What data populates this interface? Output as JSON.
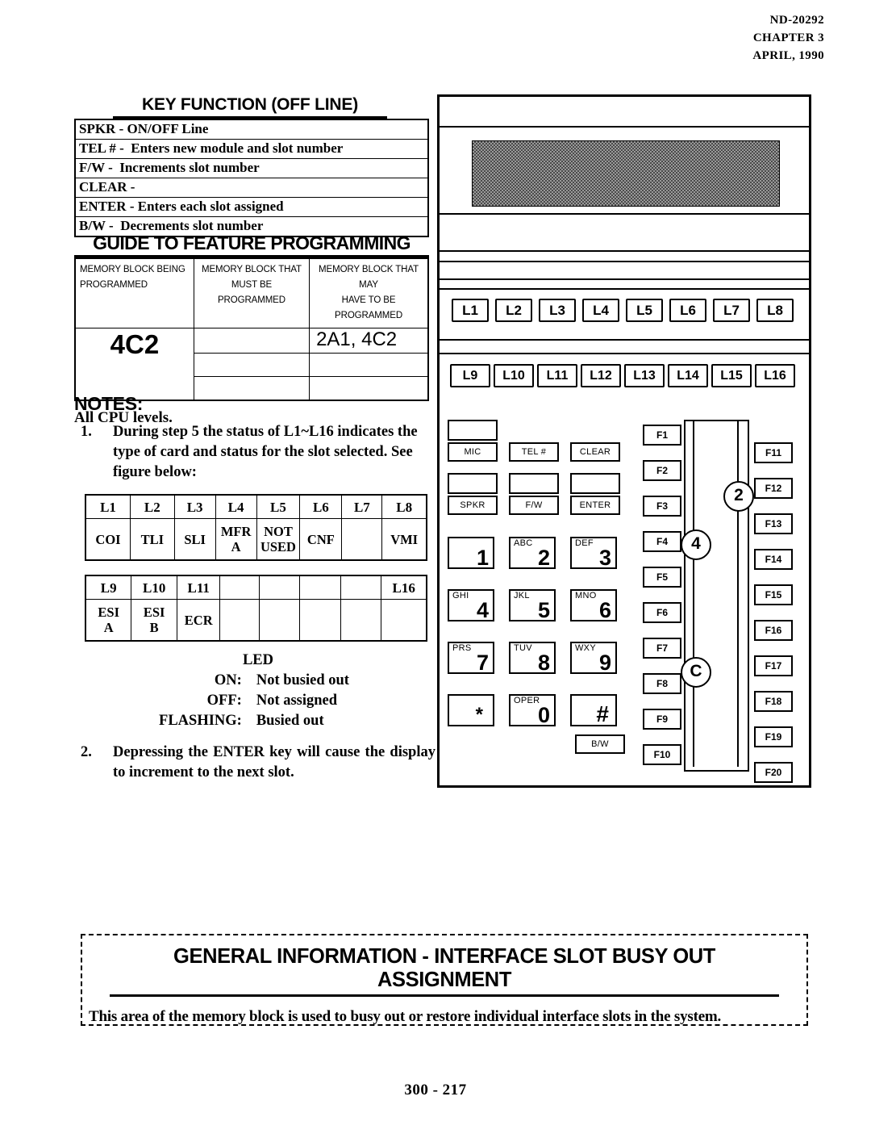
{
  "header": {
    "doc_number": "ND-20292",
    "chapter": "CHAPTER 3",
    "date": "APRIL, 1990"
  },
  "key_function": {
    "title": "KEY FUNCTION (OFF LINE)",
    "rows": [
      {
        "key": "SPKR",
        "sep": "-",
        "desc": "ON/OFF Line"
      },
      {
        "key": "TEL #",
        "sep": "-",
        "desc": "Enters new module and slot number"
      },
      {
        "key": "F/W",
        "sep": "-",
        "desc": "Increments slot number"
      },
      {
        "key": "CLEAR",
        "sep": "-",
        "desc": ""
      },
      {
        "key": "ENTER",
        "sep": "-",
        "desc": "Enters each slot assigned"
      },
      {
        "key": "B/W",
        "sep": "-",
        "desc": "Decrements slot number"
      }
    ]
  },
  "guide": {
    "title": "GUIDE TO FEATURE PROGRAMMING",
    "col1_line1": "MEMORY BLOCK BEING",
    "col1_line2": "PROGRAMMED",
    "col2_line1": "MEMORY BLOCK THAT",
    "col2_line2": "MUST BE PROGRAMMED",
    "col3_line1": "MEMORY BLOCK THAT MAY",
    "col3_line2": "HAVE TO BE PROGRAMMED",
    "block_being_programmed": "4C2",
    "must_be_programmed": [
      "",
      "",
      ""
    ],
    "may_have_to_be_programmed": [
      "2A1, 4C2",
      "",
      ""
    ],
    "footnote": "All CPU levels."
  },
  "notes": {
    "title": "NOTES:",
    "note1_number": "1.",
    "note1_text": "During step 5 the status of L1~L16 indicates the type of card and status for the slot selected.  See figure below:",
    "note2_number": "2.",
    "note2_text": "Depressing the ENTER key will cause the display to increment to the next slot."
  },
  "slot_table_1": {
    "headers": [
      "L1",
      "L2",
      "L3",
      "L4",
      "L5",
      "L6",
      "L7",
      "L8"
    ],
    "values": [
      "COI",
      "TLI",
      "SLI",
      "MFR\nA",
      "NOT\nUSED",
      "CNF",
      "",
      "VMI"
    ]
  },
  "slot_table_2": {
    "headers": [
      "L9",
      "L10",
      "L11",
      "",
      "",
      "",
      "",
      "L16"
    ],
    "values": [
      "ESI\nA",
      "ESI\nB",
      "ECR",
      "",
      "",
      "",
      "",
      ""
    ]
  },
  "led_legend": {
    "title": "LED",
    "rows": [
      {
        "state": "ON:",
        "meaning": "Not busied out"
      },
      {
        "state": "OFF:",
        "meaning": "Not assigned"
      },
      {
        "state": "FLASHING:",
        "meaning": "Busied out"
      }
    ]
  },
  "phone": {
    "line_keys_row1": [
      "L1",
      "L2",
      "L3",
      "L4",
      "L5",
      "L6",
      "L7",
      "L8"
    ],
    "line_keys_row2": [
      "L9",
      "L10",
      "L11",
      "L12",
      "L13",
      "L14",
      "L15",
      "L16"
    ],
    "function_keys": [
      "MIC",
      "TEL #",
      "CLEAR",
      "SPKR",
      "F/W",
      "ENTER"
    ],
    "keypad": [
      {
        "letters": "",
        "digit": "1"
      },
      {
        "letters": "ABC",
        "digit": "2"
      },
      {
        "letters": "DEF",
        "digit": "3"
      },
      {
        "letters": "GHI",
        "digit": "4"
      },
      {
        "letters": "JKL",
        "digit": "5"
      },
      {
        "letters": "MNO",
        "digit": "6"
      },
      {
        "letters": "PRS",
        "digit": "7"
      },
      {
        "letters": "TUV",
        "digit": "8"
      },
      {
        "letters": "WXY",
        "digit": "9"
      },
      {
        "letters": "",
        "digit": "*"
      },
      {
        "letters": "OPER",
        "digit": "0"
      },
      {
        "letters": "",
        "digit": "#"
      }
    ],
    "bw_key": "B/W",
    "f_keys_left": [
      "F1",
      "F2",
      "F3",
      "F4",
      "F5",
      "F6",
      "F7",
      "F8",
      "F9",
      "F10"
    ],
    "f_keys_right": [
      "F11",
      "F12",
      "F13",
      "F14",
      "F15",
      "F16",
      "F17",
      "F18",
      "F19",
      "F20"
    ],
    "markers": [
      "2",
      "4",
      "C"
    ]
  },
  "general_info": {
    "title": "GENERAL INFORMATION  -  INTERFACE SLOT BUSY OUT ASSIGNMENT",
    "body": "This area of the memory block is used to busy out or restore individual interface slots in the system."
  },
  "page_number": "300 - 217"
}
